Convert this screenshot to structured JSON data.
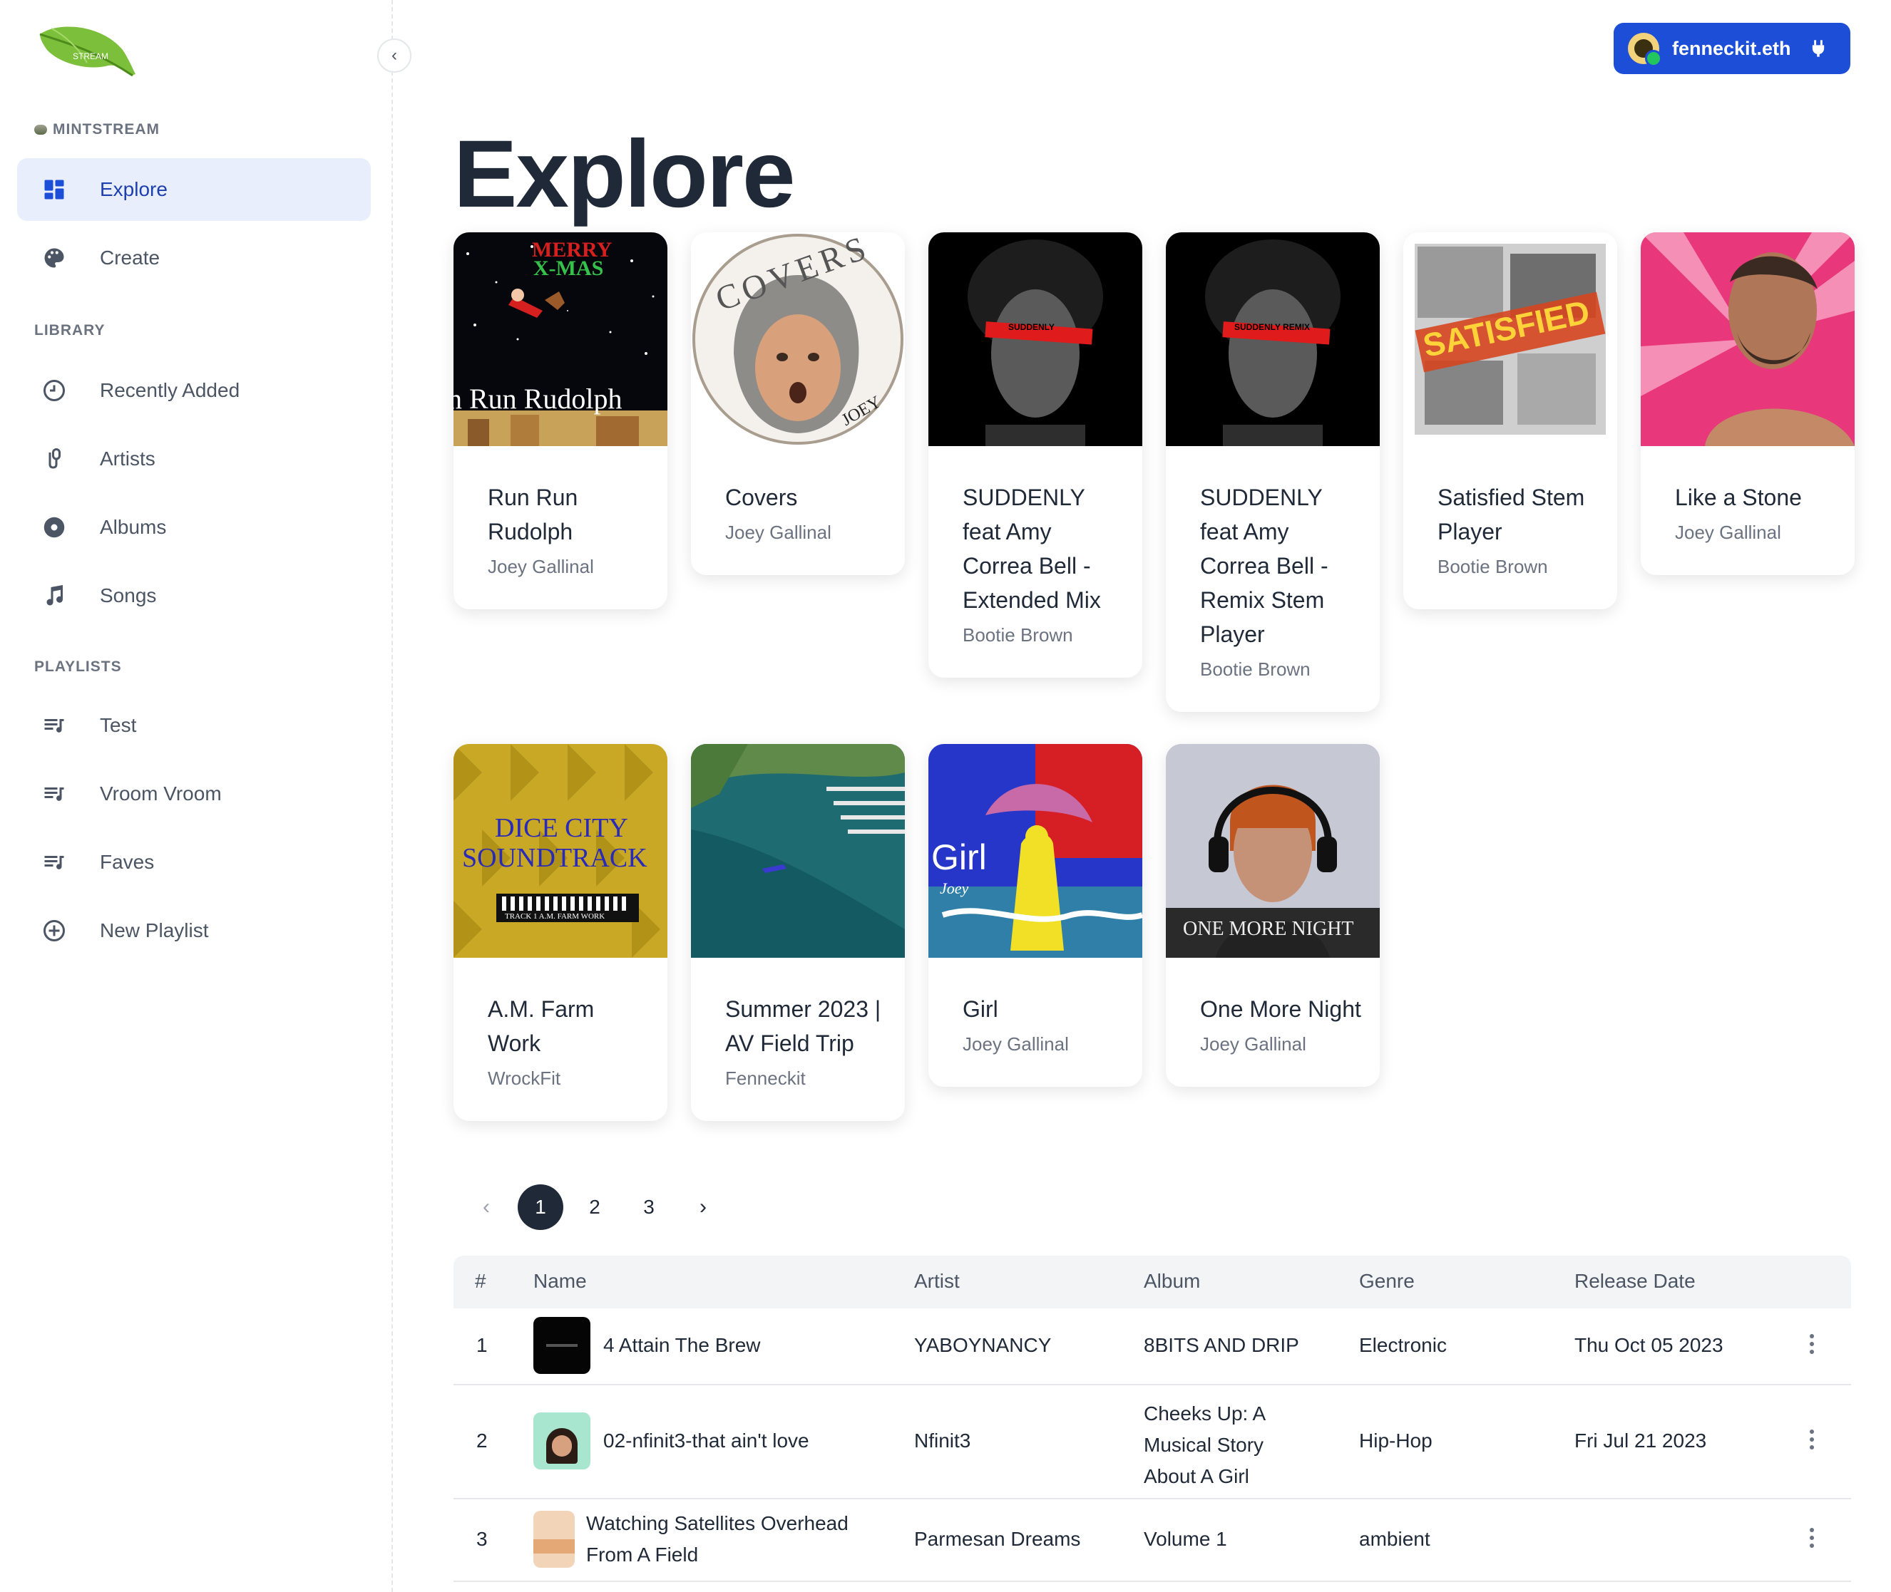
{
  "brand": {
    "section": "MINTSTREAM",
    "logo_text": "STREAM"
  },
  "sidebar": {
    "main": [
      {
        "label": "Explore",
        "icon": "dashboard-icon",
        "active": true
      },
      {
        "label": "Create",
        "icon": "palette-icon"
      }
    ],
    "library_label": "LIBRARY",
    "library": [
      {
        "label": "Recently Added",
        "icon": "clock-icon"
      },
      {
        "label": "Artists",
        "icon": "microphone-icon"
      },
      {
        "label": "Albums",
        "icon": "album-icon"
      },
      {
        "label": "Songs",
        "icon": "music-note-icon"
      }
    ],
    "playlists_label": "PLAYLISTS",
    "playlists": [
      {
        "label": "Test",
        "icon": "playlist-icon"
      },
      {
        "label": "Vroom Vroom",
        "icon": "playlist-icon"
      },
      {
        "label": "Faves",
        "icon": "playlist-icon"
      },
      {
        "label": "New Playlist",
        "icon": "add-circle-icon"
      }
    ]
  },
  "user": {
    "name": "fenneckit.eth"
  },
  "page": {
    "title": "Explore"
  },
  "cards": [
    {
      "title": "Run Run Rudolph",
      "artist": "Joey Gallinal",
      "cover_text": [
        "MERRY",
        "X-MAS",
        "n Run Rudolph"
      ]
    },
    {
      "title": "Covers",
      "artist": "Joey Gallinal",
      "cover_text": [
        "COVERS",
        "JOEY"
      ]
    },
    {
      "title": "SUDDENLY feat Amy Correa Bell - Extended Mix",
      "artist": "Bootie Brown",
      "cover_text": [
        "SUDDENLY"
      ]
    },
    {
      "title": "SUDDENLY feat Amy Correa Bell - Remix Stem Player",
      "artist": "Bootie Brown",
      "cover_text": [
        "SUDDENLY REMIX"
      ]
    },
    {
      "title": "Satisfied Stem Player",
      "artist": "Bootie Brown",
      "cover_text": [
        "SATISFIED"
      ]
    },
    {
      "title": "Like a Stone",
      "artist": "Joey Gallinal",
      "cover_text": []
    },
    {
      "title": "A.M. Farm Work",
      "artist": "WrockFit",
      "cover_text": [
        "DICE CITY",
        "SOUNDTRACK",
        "TRACK 1 A.M. FARM WORK"
      ]
    },
    {
      "title": "Summer 2023 | AV Field Trip",
      "artist": "Fenneckit",
      "cover_text": []
    },
    {
      "title": "Girl",
      "artist": "Joey Gallinal",
      "cover_text": [
        "Girl",
        "Joey"
      ]
    },
    {
      "title": "One More Night",
      "artist": "Joey Gallinal",
      "cover_text": [
        "ONE MORE NIGHT"
      ]
    }
  ],
  "pagination": {
    "pages": [
      "1",
      "2",
      "3"
    ],
    "current": "1",
    "prev": "‹",
    "next": "›"
  },
  "table": {
    "headers": {
      "num": "#",
      "name": "Name",
      "artist": "Artist",
      "album": "Album",
      "genre": "Genre",
      "release": "Release Date"
    },
    "rows": [
      {
        "num": "1",
        "name": "4 Attain The Brew",
        "artist": "YABOYNANCY",
        "album": "8BITS AND DRIP",
        "genre": "Electronic",
        "release": "Thu Oct 05 2023"
      },
      {
        "num": "2",
        "name": "02-nfinit3-that ain't love",
        "artist": "Nfinit3",
        "album": "Cheeks Up: A Musical Story About A Girl",
        "genre": "Hip-Hop",
        "release": "Fri Jul 21 2023"
      },
      {
        "num": "3",
        "name": "Watching Satellites Overhead From A Field",
        "artist": "Parmesan Dreams",
        "album": "Volume 1",
        "genre": "ambient",
        "release": ""
      }
    ]
  },
  "colors": {
    "accent": "#1d4ed8",
    "active_bg": "#e8eefb",
    "text": "#1f2937",
    "muted": "#6b7280"
  }
}
